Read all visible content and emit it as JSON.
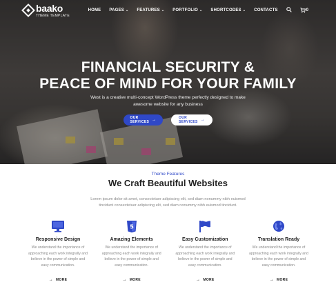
{
  "brand": {
    "name": "baako",
    "subtitle": "THEME TEMPLATE"
  },
  "nav": {
    "items": [
      {
        "label": "HOME",
        "has_dropdown": false
      },
      {
        "label": "PAGES",
        "has_dropdown": true
      },
      {
        "label": "FEATURES",
        "has_dropdown": true
      },
      {
        "label": "PORTFOLIO",
        "has_dropdown": true
      },
      {
        "label": "SHORTCODES",
        "has_dropdown": true
      },
      {
        "label": "CONTACTS",
        "has_dropdown": false
      }
    ],
    "search_icon": "search-icon",
    "cart_icon": "cart-icon",
    "cart_count": "0"
  },
  "hero": {
    "headline_line1": "FINANCIAL SECURITY &",
    "headline_line2": "PEACE OF MIND FOR YOUR FAMILY",
    "tagline_line1": "West is a creative multi-concept WordPress theme perfectly designed to make",
    "tagline_line2": "awesome website for any business",
    "btn_primary": "OUR SERVICES",
    "btn_secondary": "OUR SERVICES"
  },
  "features_section": {
    "kicker": "Theme Features",
    "title": "We Craft Beautiful Websites",
    "lead_line1": "Lorem ipsum dolor sit amet, consectetuer adipiscing elit, sed diam nonummy nibh euismod",
    "lead_line2": "tincidunt consectetuer adipiscing elit, sed diam nonummy nibh euismod tincidunt.",
    "items": [
      {
        "icon": "monitor-icon",
        "title": "Responsive Design",
        "desc1": "We understand the importance of",
        "desc2": "approaching each work integrally and",
        "desc3": "believe in the power of simple and",
        "desc4": "easy communication.",
        "more": "MORE"
      },
      {
        "icon": "html5-icon",
        "title": "Amazing Elements",
        "desc1": "We understand the importance of",
        "desc2": "approaching each work integrally and",
        "desc3": "believe in the power of simple and",
        "desc4": "easy communication.",
        "more": "MORE"
      },
      {
        "icon": "flag-icon",
        "title": "Easy Customization",
        "desc1": "We understand the importance of",
        "desc2": "approaching each work integrally and",
        "desc3": "believe in the power of simple and",
        "desc4": "easy communication.",
        "more": "MORE"
      },
      {
        "icon": "globe-icon",
        "title": "Translation Ready",
        "desc1": "We understand the importance of",
        "desc2": "approaching each work integrally and",
        "desc3": "believe in the power of simple and",
        "desc4": "easy communication.",
        "more": "MORE"
      }
    ]
  },
  "colors": {
    "accent": "#2f48c7",
    "heading": "#222222",
    "muted": "#888888"
  }
}
